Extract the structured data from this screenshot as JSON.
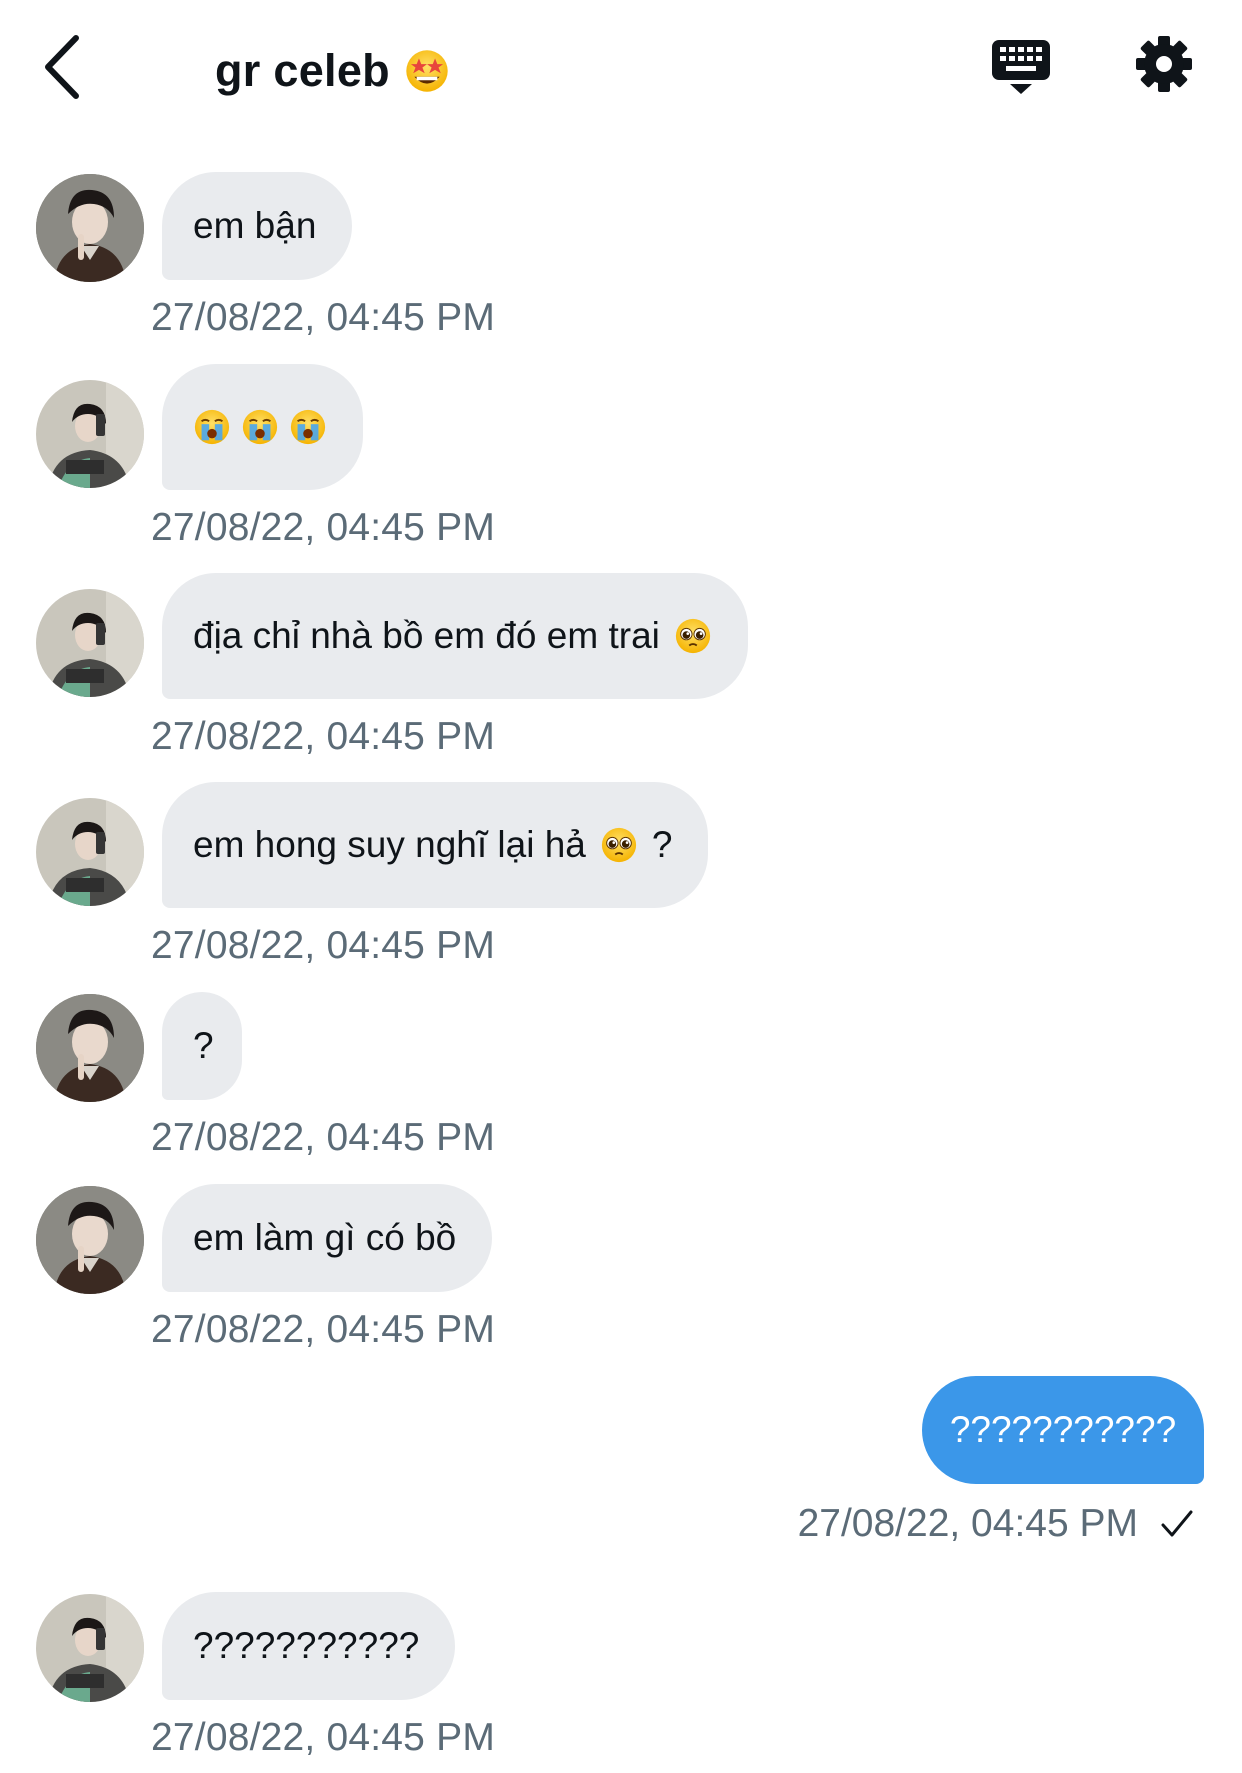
{
  "header": {
    "back_icon": "chevron-left-icon",
    "title": "gr celeb",
    "title_emoji": "star-struck-emoji",
    "keyboard_icon": "keyboard-icon",
    "settings_icon": "gear-icon"
  },
  "messages": [
    {
      "avatar": "avatar-a",
      "text": "em bận",
      "emojis": [],
      "after": "",
      "time": "27/08/22, 04:45 PM"
    },
    {
      "avatar": "avatar-b",
      "text": "",
      "emojis": [
        "crying-emoji",
        "crying-emoji",
        "crying-emoji"
      ],
      "after": "",
      "time": "27/08/22, 04:45 PM"
    },
    {
      "avatar": "avatar-b",
      "text": "địa chỉ nhà bồ em đó em trai",
      "emojis": [
        "pleading-emoji"
      ],
      "after": "",
      "time": "27/08/22, 04:45 PM"
    },
    {
      "avatar": "avatar-b",
      "text": "em hong suy nghĩ lại hả",
      "emojis": [
        "pleading-emoji"
      ],
      "after": "?",
      "time": "27/08/22, 04:45 PM"
    },
    {
      "avatar": "avatar-a",
      "text": "?",
      "emojis": [],
      "after": "",
      "time": "27/08/22, 04:45 PM"
    },
    {
      "avatar": "avatar-a",
      "text": "em làm gì có bồ",
      "emojis": [],
      "after": "",
      "time": "27/08/22, 04:45 PM"
    }
  ],
  "sent": {
    "text": "???????????",
    "time": "27/08/22, 04:45 PM",
    "status_icon": "check-icon"
  },
  "last": {
    "avatar": "avatar-b",
    "text": "???????????",
    "time": "27/08/22, 04:45 PM"
  },
  "colors": {
    "incoming_bubble": "#e9ebee",
    "outgoing_bubble": "#3b97e9",
    "timestamp": "#5b6b77"
  }
}
